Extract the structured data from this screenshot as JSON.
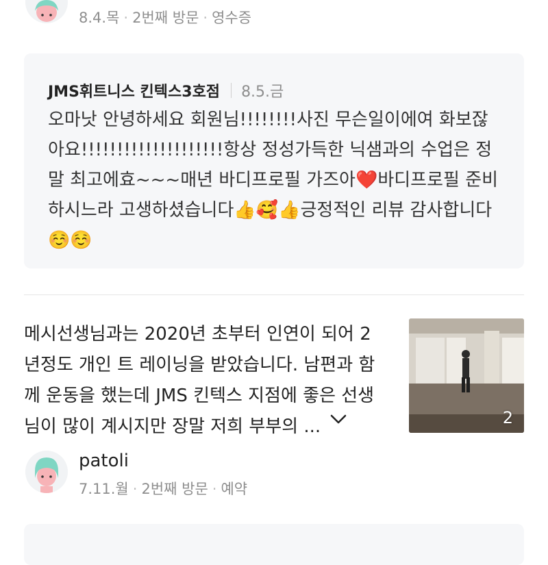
{
  "review_top": {
    "visit_date": "8.4.목",
    "visit_count": "2번째 방문",
    "visit_tag": "영수증"
  },
  "owner_reply": {
    "owner_name": "JMS휘트니스 킨텍스3호점",
    "date": "8.5.금",
    "text": "오마낫 안녕하세요 회원님!!!!!!!!사진 무슨일이에여 화보잖아요!!!!!!!!!!!!!!!!!!!!항상 정성가득한 닉샘과의 수업은 정말 최고에효~~~매년 바디프로필 가즈아❤️바디프로필 준비하시느라 고생하셨습니다👍🥰👍긍정적인 리뷰 감사합니다 ☺️☺️"
  },
  "review": {
    "text": "메시선생님과는 2020년 초부터 인연이 되어 2년정도 개인 트 레이닝을 받았습니다. 남편과 함께 운동을 했는데 JMS 킨텍스 지점에 좋은 선생님이 많이 계시지만 장말 저희 부부의 ...",
    "photo_count": "2",
    "more_icon": "chevron-down-icon",
    "photo_icon": "gym-photo-thumbnail"
  },
  "reviewer": {
    "username": "patoli",
    "visit_date": "7.11.월",
    "visit_count": "2번째 방문",
    "visit_tag": "예약",
    "avatar_icon": "avatar-icon"
  },
  "colors": {
    "reply_bg": "#f6f7f9",
    "meta_text": "#8e8e8e",
    "avatar_face": "#f7b3b7",
    "avatar_hair": "#7fd6c3"
  }
}
